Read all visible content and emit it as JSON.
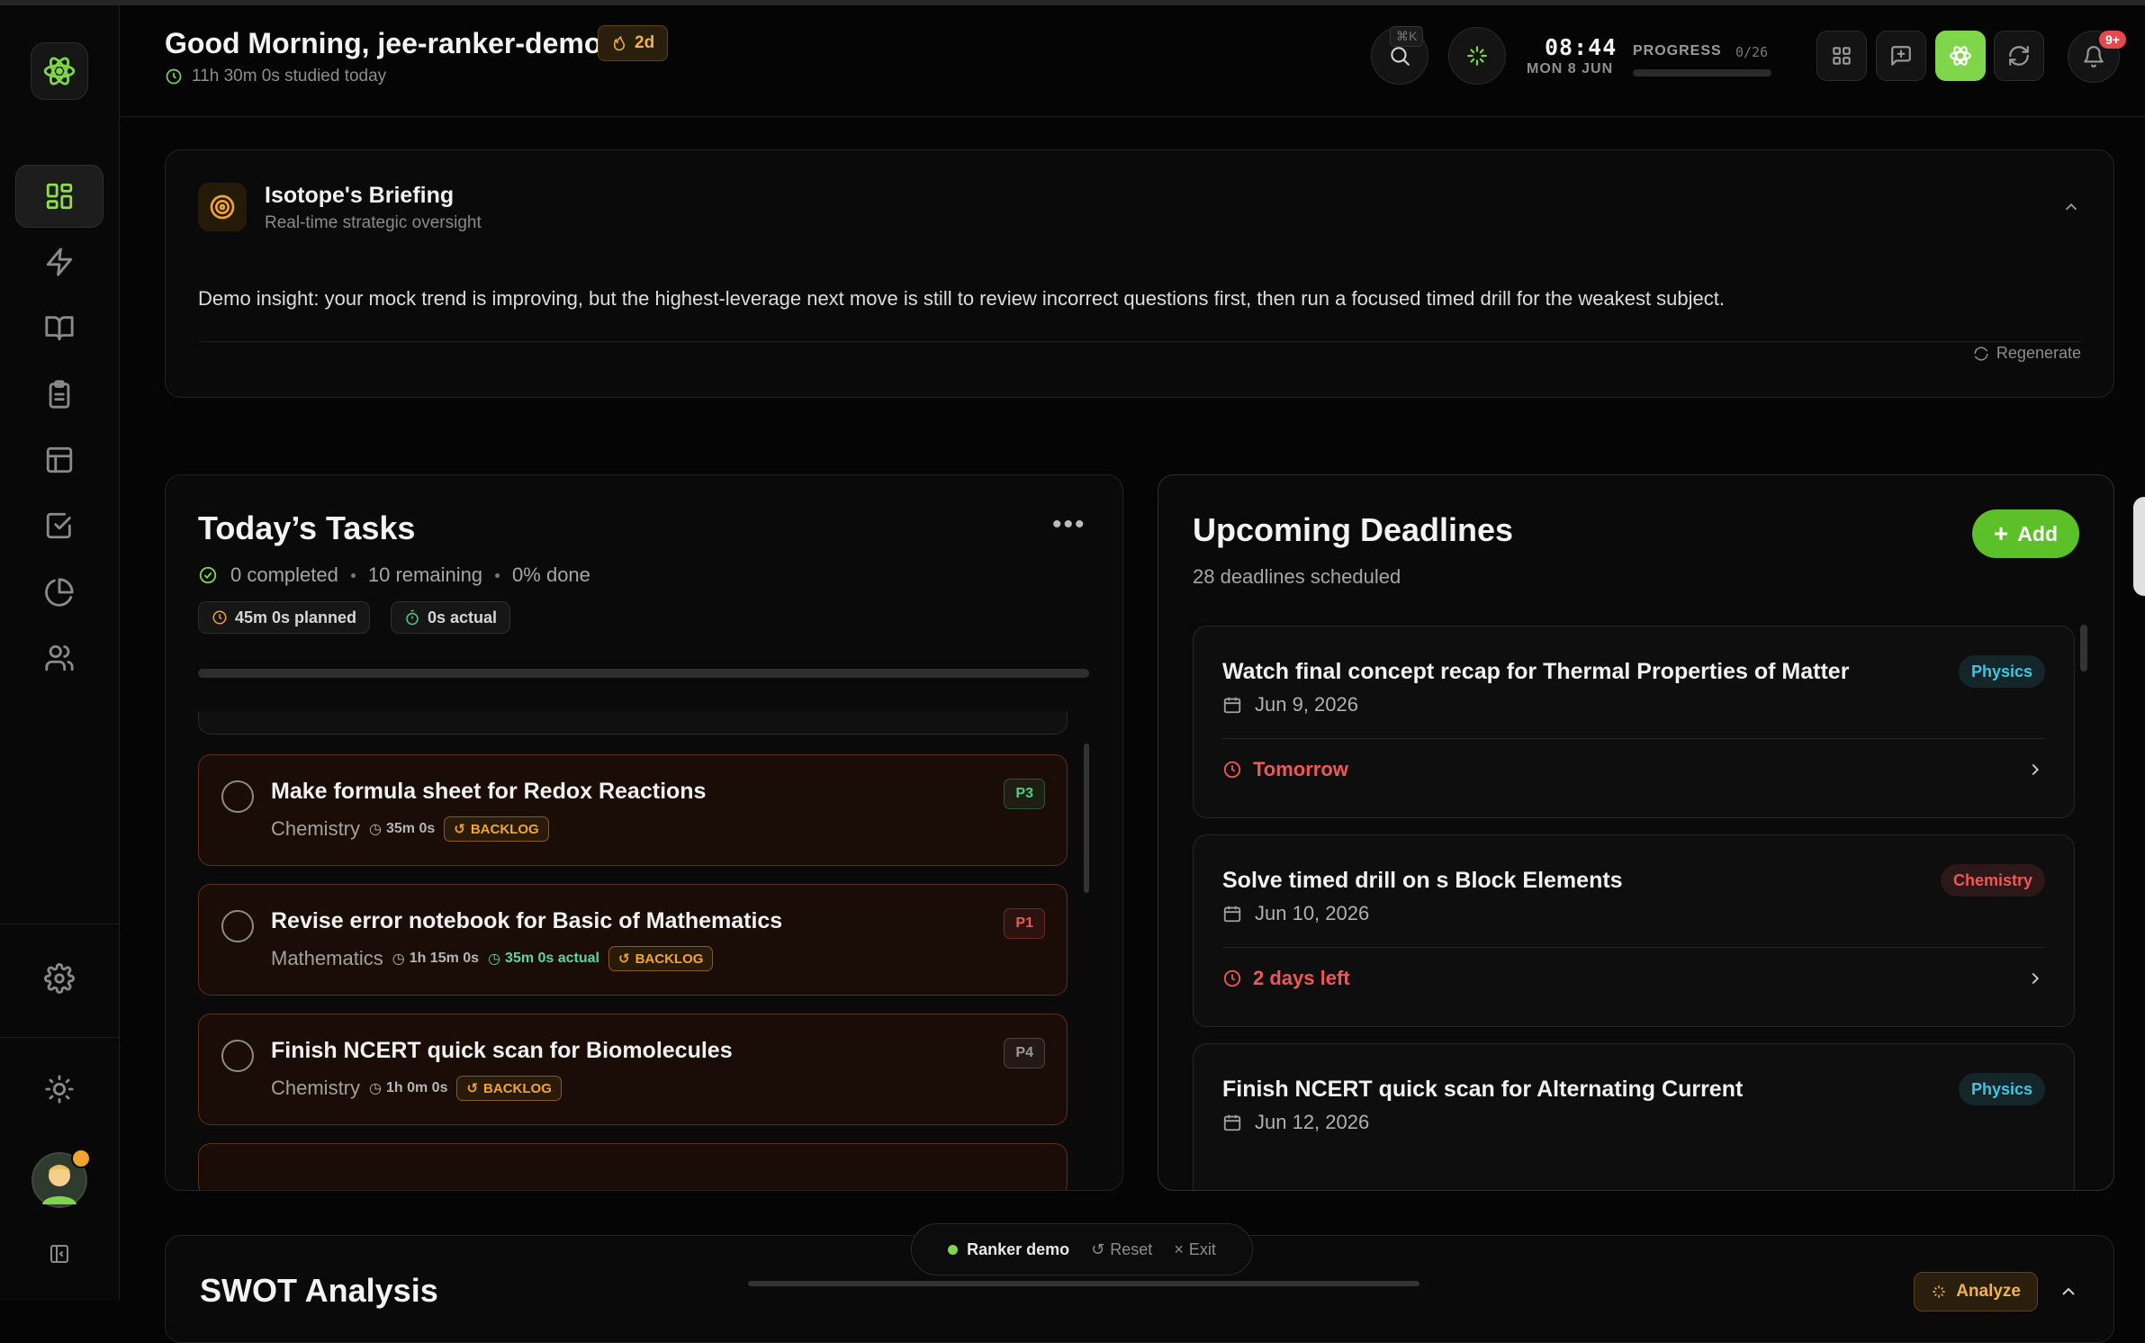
{
  "header": {
    "greeting": "Good Morning, jee-ranker-demo",
    "streak": "2d",
    "studied": "11h 30m 0s studied today",
    "shortcut": "⌘K",
    "time": "08:44",
    "date": "MON 8 JUN",
    "progress_label": "PROGRESS",
    "progress_value": "0/26",
    "progress_fraction": 0,
    "notif_count": "9+"
  },
  "briefing": {
    "title": "Isotope's Briefing",
    "subtitle": "Real-time strategic oversight",
    "text": "Demo insight: your mock trend is improving, but the highest-leverage next move is still to review incorrect questions first, then run a focused timed drill for the weakest subject.",
    "regenerate": "Regenerate"
  },
  "tasks": {
    "title": "Today’s Tasks",
    "completed": "0 completed",
    "remaining": "10 remaining",
    "done": "0% done",
    "planned": "45m 0s planned",
    "actual": "0s actual",
    "items": [
      {
        "name": "Make formula sheet for Redox Reactions",
        "subject": "Chemistry",
        "duration": "35m 0s",
        "actual": "",
        "tag": "BACKLOG",
        "priority": "P3",
        "priority_color": "#4ccf84"
      },
      {
        "name": "Revise error notebook for Basic of Mathematics",
        "subject": "Mathematics",
        "duration": "1h 15m 0s",
        "actual": "35m 0s actual",
        "tag": "BACKLOG",
        "priority": "P1",
        "priority_color": "#ef5757"
      },
      {
        "name": "Finish NCERT quick scan for Biomolecules",
        "subject": "Chemistry",
        "duration": "1h 0m 0s",
        "actual": "",
        "tag": "BACKLOG",
        "priority": "P4",
        "priority_color": "#9a9a9a"
      }
    ]
  },
  "deadlines": {
    "title": "Upcoming Deadlines",
    "subtitle": "28 deadlines scheduled",
    "add_label": "Add",
    "items": [
      {
        "name": "Watch final concept recap for Thermal Properties of Matter",
        "date": "Jun 9, 2026",
        "subject": "Physics",
        "status": "Tomorrow"
      },
      {
        "name": "Solve timed drill on s Block Elements",
        "date": "Jun 10, 2026",
        "subject": "Chemistry",
        "status": "2 days left"
      },
      {
        "name": "Finish NCERT quick scan for Alternating Current",
        "date": "Jun 12, 2026",
        "subject": "Physics",
        "status": ""
      }
    ]
  },
  "swot": {
    "title": "SWOT Analysis",
    "analyze": "Analyze"
  },
  "demo_bar": {
    "label": "Ranker demo",
    "reset": "Reset",
    "exit": "Exit"
  },
  "colors": {
    "accent": "#7fd64a",
    "backlog": "#f0a431",
    "danger": "#ef5757",
    "physics": "#3fc6e0",
    "chemistry": "#ef5757"
  }
}
